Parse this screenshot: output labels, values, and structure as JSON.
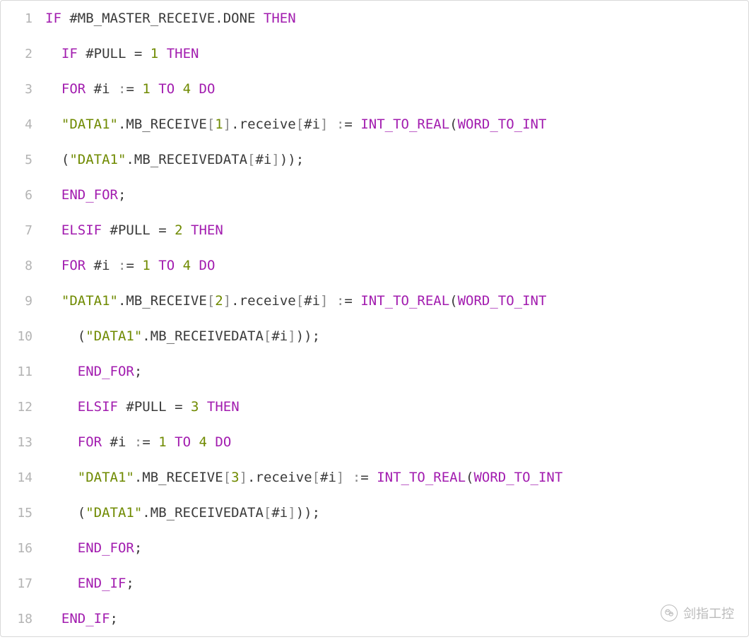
{
  "code_lines": [
    {
      "n": 1,
      "indent": 0,
      "tokens": [
        [
          "kw",
          "IF"
        ],
        [
          "sp",
          " "
        ],
        [
          "ident",
          "#MB_MASTER_RECEIVE"
        ],
        [
          "dot",
          "."
        ],
        [
          "ident",
          "DONE"
        ],
        [
          "sp",
          " "
        ],
        [
          "kw",
          "THEN"
        ]
      ]
    },
    {
      "n": 2,
      "indent": 1,
      "tokens": [
        [
          "kw",
          "IF"
        ],
        [
          "sp",
          " "
        ],
        [
          "ident",
          "#PULL"
        ],
        [
          "sp",
          " "
        ],
        [
          "op",
          "="
        ],
        [
          "sp",
          " "
        ],
        [
          "num",
          "1"
        ],
        [
          "sp",
          " "
        ],
        [
          "kw",
          "THEN"
        ]
      ]
    },
    {
      "n": 3,
      "indent": 1,
      "tokens": [
        [
          "kw",
          "FOR"
        ],
        [
          "sp",
          " "
        ],
        [
          "ident",
          "#i"
        ],
        [
          "sp",
          " "
        ],
        [
          "gray",
          ":"
        ],
        [
          "op",
          "="
        ],
        [
          "sp",
          " "
        ],
        [
          "num",
          "1"
        ],
        [
          "sp",
          " "
        ],
        [
          "kw",
          "TO"
        ],
        [
          "sp",
          " "
        ],
        [
          "num",
          "4"
        ],
        [
          "sp",
          " "
        ],
        [
          "kw",
          "DO"
        ]
      ]
    },
    {
      "n": 4,
      "indent": 1,
      "tokens": [
        [
          "str",
          "\"DATA1\""
        ],
        [
          "dot",
          "."
        ],
        [
          "ident",
          "MB_RECEIVE"
        ],
        [
          "gray",
          "["
        ],
        [
          "num",
          "1"
        ],
        [
          "gray",
          "]"
        ],
        [
          "dot",
          "."
        ],
        [
          "call",
          "receive"
        ],
        [
          "gray",
          "["
        ],
        [
          "ident",
          "#i"
        ],
        [
          "gray",
          "]"
        ],
        [
          "sp",
          " "
        ],
        [
          "gray",
          ":"
        ],
        [
          "op",
          "="
        ],
        [
          "sp",
          " "
        ],
        [
          "kw",
          "INT_TO_REAL"
        ],
        [
          "op",
          "("
        ],
        [
          "kw",
          "WORD_TO_INT"
        ]
      ]
    },
    {
      "n": 5,
      "indent": 1,
      "tokens": [
        [
          "op",
          "("
        ],
        [
          "str",
          "\"DATA1\""
        ],
        [
          "dot",
          "."
        ],
        [
          "ident",
          "MB_RECEIVEDATA"
        ],
        [
          "gray",
          "["
        ],
        [
          "ident",
          "#i"
        ],
        [
          "gray",
          "]"
        ],
        [
          "op",
          ")"
        ],
        [
          "op",
          ")"
        ],
        [
          "semi",
          ";"
        ]
      ]
    },
    {
      "n": 6,
      "indent": 1,
      "tokens": [
        [
          "kw",
          "END_FOR"
        ],
        [
          "semi",
          ";"
        ]
      ]
    },
    {
      "n": 7,
      "indent": 1,
      "tokens": [
        [
          "kw",
          "ELSIF"
        ],
        [
          "sp",
          " "
        ],
        [
          "ident",
          "#PULL"
        ],
        [
          "sp",
          " "
        ],
        [
          "op",
          "="
        ],
        [
          "sp",
          " "
        ],
        [
          "num",
          "2"
        ],
        [
          "sp",
          " "
        ],
        [
          "kw",
          "THEN"
        ]
      ]
    },
    {
      "n": 8,
      "indent": 1,
      "tokens": [
        [
          "kw",
          "FOR"
        ],
        [
          "sp",
          " "
        ],
        [
          "ident",
          "#i"
        ],
        [
          "sp",
          " "
        ],
        [
          "gray",
          ":"
        ],
        [
          "op",
          "="
        ],
        [
          "sp",
          " "
        ],
        [
          "num",
          "1"
        ],
        [
          "sp",
          " "
        ],
        [
          "kw",
          "TO"
        ],
        [
          "sp",
          " "
        ],
        [
          "num",
          "4"
        ],
        [
          "sp",
          " "
        ],
        [
          "kw",
          "DO"
        ]
      ]
    },
    {
      "n": 9,
      "indent": 1,
      "tokens": [
        [
          "str",
          "\"DATA1\""
        ],
        [
          "dot",
          "."
        ],
        [
          "ident",
          "MB_RECEIVE"
        ],
        [
          "gray",
          "["
        ],
        [
          "num",
          "2"
        ],
        [
          "gray",
          "]"
        ],
        [
          "dot",
          "."
        ],
        [
          "call",
          "receive"
        ],
        [
          "gray",
          "["
        ],
        [
          "ident",
          "#i"
        ],
        [
          "gray",
          "]"
        ],
        [
          "sp",
          " "
        ],
        [
          "gray",
          ":"
        ],
        [
          "op",
          "="
        ],
        [
          "sp",
          " "
        ],
        [
          "kw",
          "INT_TO_REAL"
        ],
        [
          "op",
          "("
        ],
        [
          "kw",
          "WORD_TO_INT"
        ]
      ]
    },
    {
      "n": 10,
      "indent": 2,
      "tokens": [
        [
          "op",
          "("
        ],
        [
          "str",
          "\"DATA1\""
        ],
        [
          "dot",
          "."
        ],
        [
          "ident",
          "MB_RECEIVEDATA"
        ],
        [
          "gray",
          "["
        ],
        [
          "ident",
          "#i"
        ],
        [
          "gray",
          "]"
        ],
        [
          "op",
          ")"
        ],
        [
          "op",
          ")"
        ],
        [
          "semi",
          ";"
        ]
      ]
    },
    {
      "n": 11,
      "indent": 2,
      "tokens": [
        [
          "kw",
          "END_FOR"
        ],
        [
          "semi",
          ";"
        ]
      ]
    },
    {
      "n": 12,
      "indent": 2,
      "tokens": [
        [
          "kw",
          "ELSIF"
        ],
        [
          "sp",
          " "
        ],
        [
          "ident",
          "#PULL"
        ],
        [
          "sp",
          " "
        ],
        [
          "op",
          "="
        ],
        [
          "sp",
          " "
        ],
        [
          "num",
          "3"
        ],
        [
          "sp",
          " "
        ],
        [
          "kw",
          "THEN"
        ]
      ]
    },
    {
      "n": 13,
      "indent": 2,
      "tokens": [
        [
          "kw",
          "FOR"
        ],
        [
          "sp",
          " "
        ],
        [
          "ident",
          "#i"
        ],
        [
          "sp",
          " "
        ],
        [
          "gray",
          ":"
        ],
        [
          "op",
          "="
        ],
        [
          "sp",
          " "
        ],
        [
          "num",
          "1"
        ],
        [
          "sp",
          " "
        ],
        [
          "kw",
          "TO"
        ],
        [
          "sp",
          " "
        ],
        [
          "num",
          "4"
        ],
        [
          "sp",
          " "
        ],
        [
          "kw",
          "DO"
        ]
      ]
    },
    {
      "n": 14,
      "indent": 2,
      "tokens": [
        [
          "str",
          "\"DATA1\""
        ],
        [
          "dot",
          "."
        ],
        [
          "ident",
          "MB_RECEIVE"
        ],
        [
          "gray",
          "["
        ],
        [
          "num",
          "3"
        ],
        [
          "gray",
          "]"
        ],
        [
          "dot",
          "."
        ],
        [
          "call",
          "receive"
        ],
        [
          "gray",
          "["
        ],
        [
          "ident",
          "#i"
        ],
        [
          "gray",
          "]"
        ],
        [
          "sp",
          " "
        ],
        [
          "gray",
          ":"
        ],
        [
          "op",
          "="
        ],
        [
          "sp",
          " "
        ],
        [
          "kw",
          "INT_TO_REAL"
        ],
        [
          "op",
          "("
        ],
        [
          "kw",
          "WORD_TO_INT"
        ]
      ]
    },
    {
      "n": 15,
      "indent": 2,
      "tokens": [
        [
          "op",
          "("
        ],
        [
          "str",
          "\"DATA1\""
        ],
        [
          "dot",
          "."
        ],
        [
          "ident",
          "MB_RECEIVEDATA"
        ],
        [
          "gray",
          "["
        ],
        [
          "ident",
          "#i"
        ],
        [
          "gray",
          "]"
        ],
        [
          "op",
          ")"
        ],
        [
          "op",
          ")"
        ],
        [
          "semi",
          ";"
        ]
      ]
    },
    {
      "n": 16,
      "indent": 2,
      "tokens": [
        [
          "kw",
          "END_FOR"
        ],
        [
          "semi",
          ";"
        ]
      ]
    },
    {
      "n": 17,
      "indent": 2,
      "tokens": [
        [
          "kw",
          "END_IF"
        ],
        [
          "semi",
          ";"
        ]
      ]
    },
    {
      "n": 18,
      "indent": 1,
      "tokens": [
        [
          "kw",
          "END_IF"
        ],
        [
          "semi",
          ";"
        ]
      ]
    }
  ],
  "watermark": {
    "text": "剑指工控",
    "icon_glyph": "✓"
  }
}
